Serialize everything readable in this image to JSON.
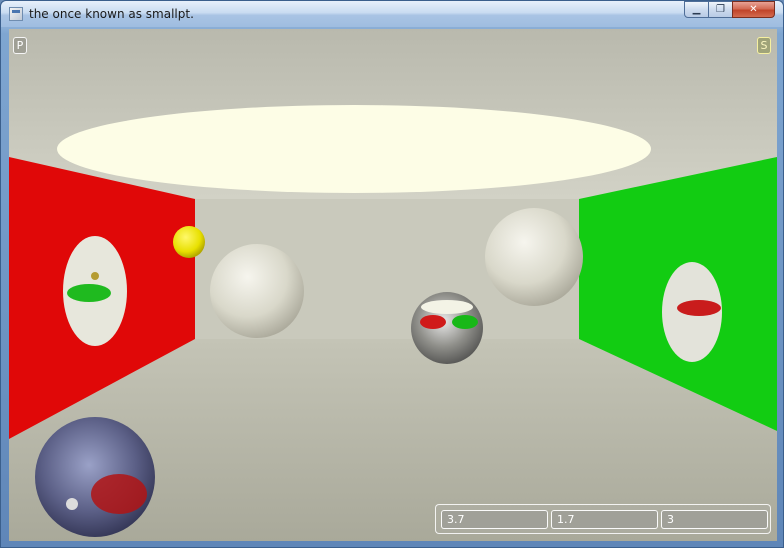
{
  "window": {
    "title": "the once known as smallpt.",
    "caption_minimize": "▁",
    "caption_maximize": "❐",
    "caption_close": "✕"
  },
  "viewport": {
    "left_button_label": "P",
    "right_button_label": "S",
    "fields": [
      {
        "value": "3.7"
      },
      {
        "value": "1.7"
      },
      {
        "value": "3"
      }
    ]
  },
  "scene": {
    "left_wall_color": "#e00808",
    "right_wall_color": "#12cc12",
    "back_wall_color": "#c9c9bc",
    "floor_color": "#bdbdb0",
    "ceiling_light_color": "#fdfde6",
    "small_sphere_color": "#e8e000"
  }
}
